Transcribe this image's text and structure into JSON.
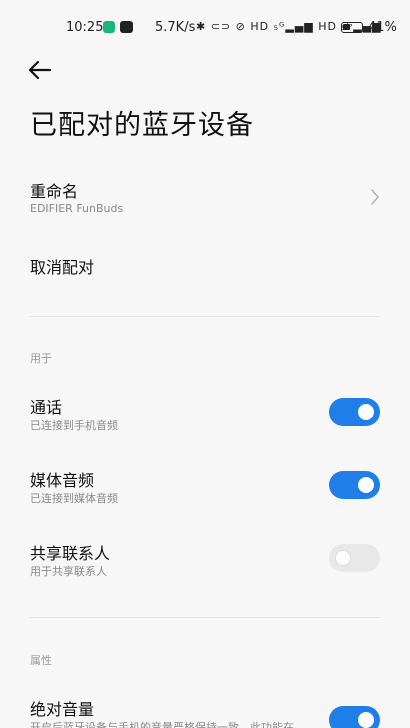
{
  "status_bar": {
    "time": "10:25",
    "net_speed": "5.7K/s",
    "icons": "✱ ⊂⊃ ⊘ HD ₅ᴳ▂▄▆ HD ₅ᴳ▂▄▆",
    "battery_level": 0.41,
    "battery_text": "41%"
  },
  "header": {
    "title": "已配对的蓝牙设备"
  },
  "rename": {
    "title": "重命名",
    "subtitle": "EDIFIER FunBuds"
  },
  "unpair": {
    "title": "取消配对"
  },
  "usage_section": {
    "label": "用于",
    "items": [
      {
        "title": "通话",
        "subtitle": "已连接到手机音频",
        "enabled": true
      },
      {
        "title": "媒体音频",
        "subtitle": "已连接到媒体音频",
        "enabled": true
      },
      {
        "title": "共享联系人",
        "subtitle": "用于共享联系人",
        "enabled": false
      }
    ]
  },
  "properties_section": {
    "label": "属性",
    "items": [
      {
        "title": "绝对音量",
        "subtitle": "开启后蓝牙设备与手机的音量严格保持一致，此功能在",
        "enabled": true
      }
    ]
  },
  "colors": {
    "accent": "#1f7ee8",
    "background": "#f7f7f7"
  }
}
